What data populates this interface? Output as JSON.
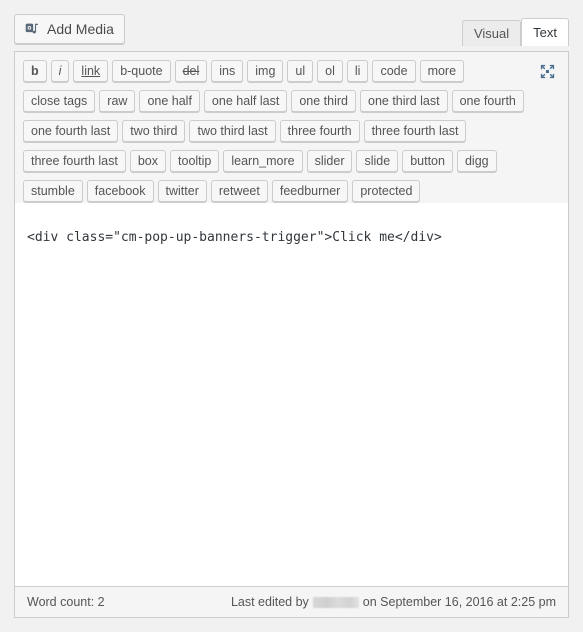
{
  "toolbar": {
    "add_media_label": "Add Media",
    "add_media_icon": "media-icon",
    "fullscreen_icon": "distraction-free-writing-icon"
  },
  "tabs": [
    {
      "label": "Visual",
      "active": false
    },
    {
      "label": "Text",
      "active": true
    }
  ],
  "quicktags": {
    "rows": [
      [
        {
          "label": "b",
          "style": "bold"
        },
        {
          "label": "i",
          "style": "italic"
        },
        {
          "label": "link",
          "style": "underline"
        },
        {
          "label": "b-quote",
          "style": ""
        },
        {
          "label": "del",
          "style": "strike"
        },
        {
          "label": "ins",
          "style": ""
        },
        {
          "label": "img",
          "style": ""
        },
        {
          "label": "ul",
          "style": ""
        },
        {
          "label": "ol",
          "style": ""
        },
        {
          "label": "li",
          "style": ""
        },
        {
          "label": "code",
          "style": ""
        },
        {
          "label": "more",
          "style": ""
        }
      ],
      [
        {
          "label": "close tags",
          "style": ""
        },
        {
          "label": "raw",
          "style": ""
        },
        {
          "label": "one half",
          "style": ""
        },
        {
          "label": "one half last",
          "style": ""
        },
        {
          "label": "one third",
          "style": ""
        },
        {
          "label": "one third last",
          "style": ""
        },
        {
          "label": "one fourth",
          "style": ""
        }
      ],
      [
        {
          "label": "one fourth last",
          "style": ""
        },
        {
          "label": "two third",
          "style": ""
        },
        {
          "label": "two third last",
          "style": ""
        },
        {
          "label": "three fourth",
          "style": ""
        },
        {
          "label": "three fourth last",
          "style": ""
        }
      ],
      [
        {
          "label": "three fourth last",
          "style": ""
        },
        {
          "label": "box",
          "style": ""
        },
        {
          "label": "tooltip",
          "style": ""
        },
        {
          "label": "learn_more",
          "style": ""
        },
        {
          "label": "slider",
          "style": ""
        },
        {
          "label": "slide",
          "style": ""
        },
        {
          "label": "button",
          "style": ""
        },
        {
          "label": "digg",
          "style": ""
        }
      ],
      [
        {
          "label": "stumble",
          "style": ""
        },
        {
          "label": "facebook",
          "style": ""
        },
        {
          "label": "twitter",
          "style": ""
        },
        {
          "label": "retweet",
          "style": ""
        },
        {
          "label": "feedburner",
          "style": ""
        },
        {
          "label": "protected",
          "style": ""
        }
      ]
    ]
  },
  "editor": {
    "content": "<div class=\"cm-pop-up-banners-trigger\">Click me</div>"
  },
  "status": {
    "word_count_label": "Word count: 2",
    "last_edited_prefix": "Last edited by",
    "author_redacted": true,
    "last_edited_suffix": "on September 16, 2016 at 2:25 pm"
  },
  "colors": {
    "panel_bg": "#f5f5f5",
    "page_bg": "#f1f1f1",
    "border": "#cccccc",
    "text": "#555555",
    "editor_text": "#32373c",
    "icon_blue": "#4a6f91"
  }
}
